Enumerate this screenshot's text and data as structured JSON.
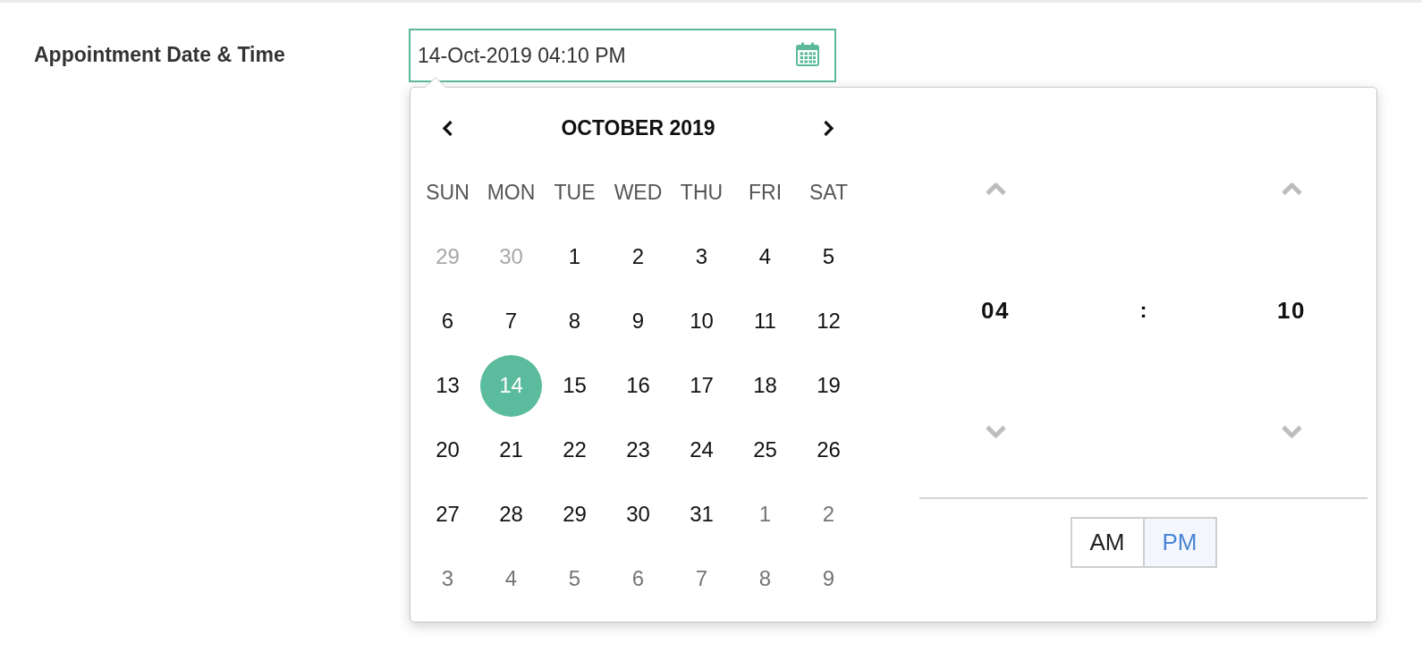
{
  "form": {
    "label": "Appointment Date & Time",
    "value": "14-Oct-2019 04:10 PM"
  },
  "date_picker": {
    "month_title": "OCTOBER 2019",
    "weekdays": [
      "SUN",
      "MON",
      "TUE",
      "WED",
      "THU",
      "FRI",
      "SAT"
    ],
    "days": [
      {
        "label": "29",
        "kind": "previous",
        "selected": false
      },
      {
        "label": "30",
        "kind": "previous",
        "selected": false
      },
      {
        "label": "1",
        "kind": "current",
        "selected": false
      },
      {
        "label": "2",
        "kind": "current",
        "selected": false
      },
      {
        "label": "3",
        "kind": "current",
        "selected": false
      },
      {
        "label": "4",
        "kind": "current",
        "selected": false
      },
      {
        "label": "5",
        "kind": "current",
        "selected": false
      },
      {
        "label": "6",
        "kind": "current",
        "selected": false
      },
      {
        "label": "7",
        "kind": "current",
        "selected": false
      },
      {
        "label": "8",
        "kind": "current",
        "selected": false
      },
      {
        "label": "9",
        "kind": "current",
        "selected": false
      },
      {
        "label": "10",
        "kind": "current",
        "selected": false
      },
      {
        "label": "11",
        "kind": "current",
        "selected": false
      },
      {
        "label": "12",
        "kind": "current",
        "selected": false
      },
      {
        "label": "13",
        "kind": "current",
        "selected": false
      },
      {
        "label": "14",
        "kind": "current",
        "selected": true
      },
      {
        "label": "15",
        "kind": "current",
        "selected": false
      },
      {
        "label": "16",
        "kind": "current",
        "selected": false
      },
      {
        "label": "17",
        "kind": "current",
        "selected": false
      },
      {
        "label": "18",
        "kind": "current",
        "selected": false
      },
      {
        "label": "19",
        "kind": "current",
        "selected": false
      },
      {
        "label": "20",
        "kind": "current",
        "selected": false
      },
      {
        "label": "21",
        "kind": "current",
        "selected": false
      },
      {
        "label": "22",
        "kind": "current",
        "selected": false
      },
      {
        "label": "23",
        "kind": "current",
        "selected": false
      },
      {
        "label": "24",
        "kind": "current",
        "selected": false
      },
      {
        "label": "25",
        "kind": "current",
        "selected": false
      },
      {
        "label": "26",
        "kind": "current",
        "selected": false
      },
      {
        "label": "27",
        "kind": "current",
        "selected": false
      },
      {
        "label": "28",
        "kind": "current",
        "selected": false
      },
      {
        "label": "29",
        "kind": "current",
        "selected": false
      },
      {
        "label": "30",
        "kind": "current",
        "selected": false
      },
      {
        "label": "31",
        "kind": "current",
        "selected": false
      },
      {
        "label": "1",
        "kind": "next",
        "selected": false
      },
      {
        "label": "2",
        "kind": "next",
        "selected": false
      },
      {
        "label": "3",
        "kind": "next",
        "selected": false
      },
      {
        "label": "4",
        "kind": "next",
        "selected": false
      },
      {
        "label": "5",
        "kind": "next",
        "selected": false
      },
      {
        "label": "6",
        "kind": "next",
        "selected": false
      },
      {
        "label": "7",
        "kind": "next",
        "selected": false
      },
      {
        "label": "8",
        "kind": "next",
        "selected": false
      },
      {
        "label": "9",
        "kind": "next",
        "selected": false
      }
    ]
  },
  "time_picker": {
    "hour": "04",
    "separator": ":",
    "minute": "10",
    "periods": [
      {
        "label": "AM",
        "selected": false
      },
      {
        "label": "PM",
        "selected": true
      }
    ]
  }
}
